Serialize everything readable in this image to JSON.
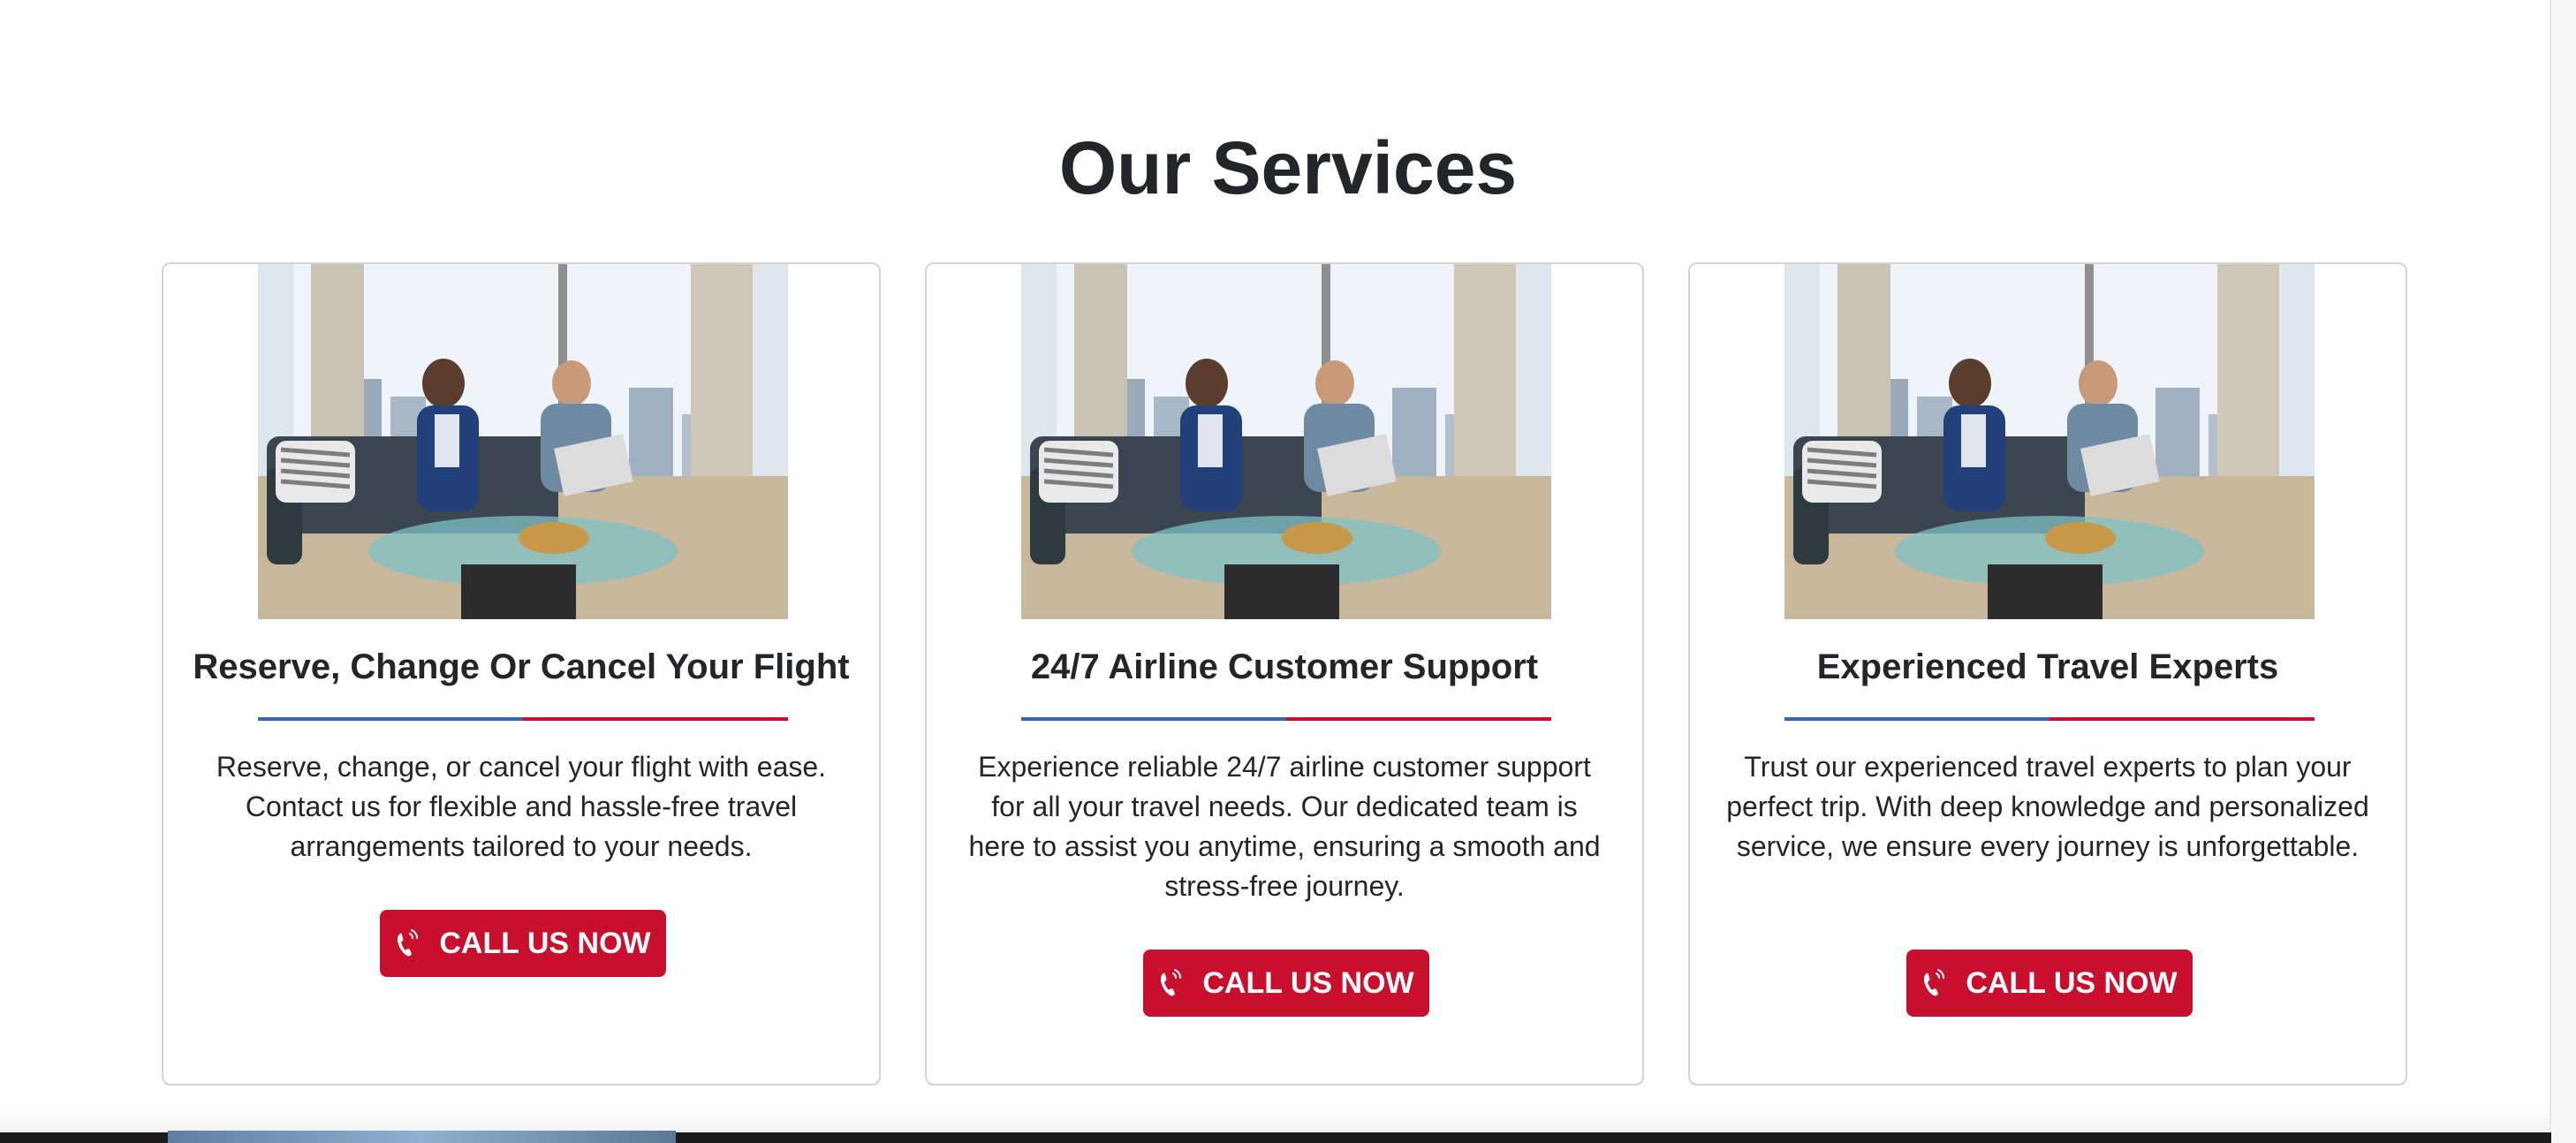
{
  "section": {
    "title": "Our Services"
  },
  "cards": [
    {
      "title": "Reserve, Change Or Cancel Your Flight",
      "text": "Reserve, change, or cancel your flight with ease. Contact us for flexible and hassle-free travel arrangements tailored to your needs.",
      "button_label": "CALL US NOW",
      "button_icon": "phone-icon"
    },
    {
      "title": "24/7 Airline Customer Support",
      "text": "Experience reliable 24/7 airline customer support for all your travel needs. Our dedicated team is here to assist you anytime, ensuring a smooth and stress-free journey.",
      "button_label": "CALL US NOW",
      "button_icon": "phone-icon"
    },
    {
      "title": "Experienced Travel Experts",
      "text": "Trust our experienced travel experts to plan your perfect trip. With deep knowledge and personalized service, we ensure every journey is unforgettable.",
      "button_label": "CALL US NOW",
      "button_icon": "phone-icon"
    }
  ],
  "colors": {
    "accent_red": "#c8102e",
    "accent_blue": "#3b63b5",
    "text_dark": "#222529",
    "card_border": "#d4d4d4"
  }
}
